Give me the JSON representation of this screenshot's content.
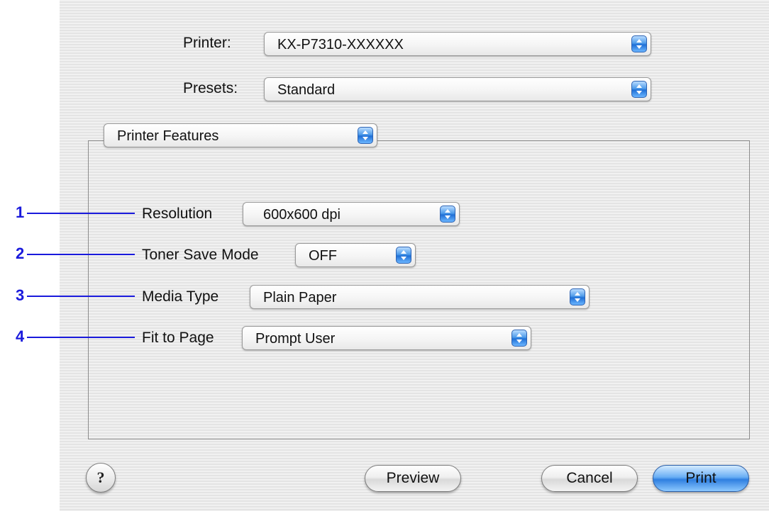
{
  "printer": {
    "label": "Printer:",
    "value": "KX-P7310-XXXXXX"
  },
  "presets": {
    "label": "Presets:",
    "value": "Standard"
  },
  "panel": {
    "value": "Printer Features"
  },
  "features": [
    {
      "callout": "1",
      "label": "Resolution",
      "value": "600x600 dpi"
    },
    {
      "callout": "2",
      "label": "Toner Save Mode",
      "value": "OFF"
    },
    {
      "callout": "3",
      "label": "Media Type",
      "value": "Plain Paper"
    },
    {
      "callout": "4",
      "label": "Fit to Page",
      "value": "Prompt User"
    }
  ],
  "buttons": {
    "help": "?",
    "preview": "Preview",
    "cancel": "Cancel",
    "print": "Print"
  },
  "colors": {
    "callout": "#1a1adc",
    "default_button": "#2f7fe0"
  },
  "icons": {
    "popup_arrow": "updown-arrows-icon",
    "help": "question-mark-icon"
  }
}
